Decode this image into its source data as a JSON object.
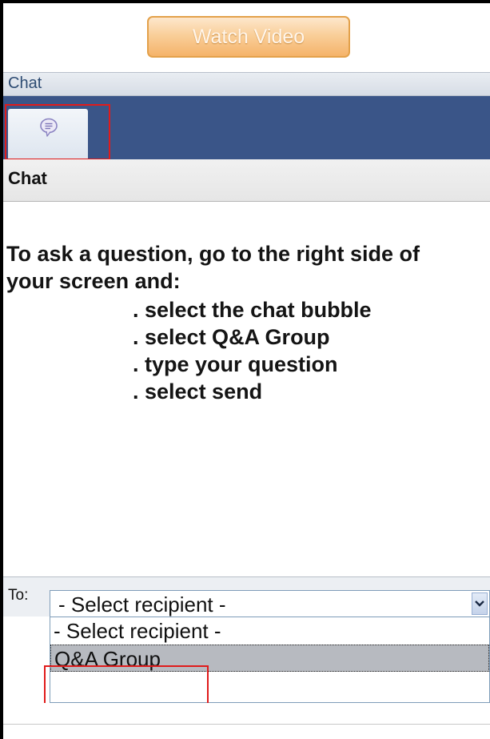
{
  "toolbar": {
    "watch_video_label": "Watch Video"
  },
  "section": {
    "title": "Chat"
  },
  "tabs": [
    {
      "icon": "chat-bubble-icon",
      "selected": true
    }
  ],
  "panel": {
    "title": "Chat"
  },
  "message": {
    "line1": "To ask a question, go to the right side of",
    "line2": "your screen and:",
    "steps": [
      ". select the chat bubble",
      ". select Q&A Group",
      ". type your question",
      ". select send"
    ]
  },
  "recipient": {
    "label": "To:",
    "selected_value": "- Select recipient -",
    "options": [
      "- Select recipient -",
      "Q&A Group"
    ],
    "highlighted_option": "Q&A Group"
  },
  "colors": {
    "tab_bar": "#3a5588",
    "button_orange": "#f5b36a",
    "highlight_red": "#e01b1b",
    "option_highlight": "#b7bac0"
  }
}
